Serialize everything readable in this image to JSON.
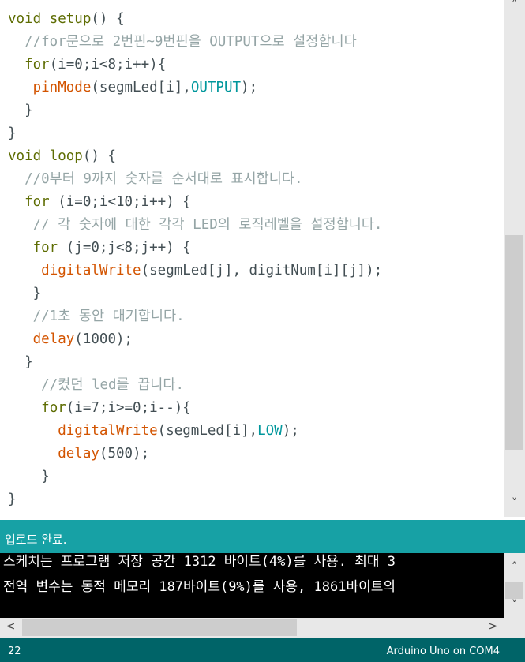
{
  "editor": {
    "lines": {
      "l1": {
        "a": "void",
        "b": " ",
        "c": "setup",
        "d": "() {"
      },
      "l2": {
        "a": "  //for문으로 2번핀~9번핀을 OUTPUT으로 설정합니다"
      },
      "l3": {
        "a": "  ",
        "b": "for",
        "c": "(i=0;i<8;i++){"
      },
      "l4": {
        "a": "   ",
        "b": "pinMode",
        "c": "(segmLed[i],",
        "d": "OUTPUT",
        "e": ");"
      },
      "l5": {
        "a": "  }"
      },
      "l6": {
        "a": "}"
      },
      "l7": {
        "a": "void",
        "b": " ",
        "c": "loop",
        "d": "() {"
      },
      "l8": {
        "a": "  //0부터 9까지 숫자를 순서대로 표시합니다."
      },
      "l9": {
        "a": "  ",
        "b": "for",
        "c": " (i=0;i<10;i++) {"
      },
      "l10": {
        "a": "   // 각 숫자에 대한 각각 LED의 로직레벨을 설정합니다."
      },
      "l11": {
        "a": "   ",
        "b": "for",
        "c": " (j=0;j<8;j++) {"
      },
      "l12": {
        "a": "    ",
        "b": "digitalWrite",
        "c": "(segmLed[j], digitNum[i][j]);"
      },
      "l13": {
        "a": "   }"
      },
      "l14": {
        "a": "   //1초 동안 대기합니다."
      },
      "l15": {
        "a": "   ",
        "b": "delay",
        "c": "(1000);"
      },
      "l16": {
        "a": "  }"
      },
      "l17": {
        "a": "    //켰던 led를 끕니다."
      },
      "l18": {
        "a": "    ",
        "b": "for",
        "c": "(i=7;i>=0;i--){"
      },
      "l19": {
        "a": "      ",
        "b": "digitalWrite",
        "c": "(segmLed[i],",
        "d": "LOW",
        "e": ");"
      },
      "l20": {
        "a": "      ",
        "b": "delay",
        "c": "(500);"
      },
      "l21": {
        "a": "    }"
      },
      "l22": {
        "a": "}"
      }
    }
  },
  "status": {
    "message": "업로드 완료."
  },
  "console": {
    "line1": "스케치는 프로그램 저장 공간 1312 바이트(4%)를 사용. 최대 3",
    "line2": "전역 변수는 동적 메모리 187바이트(9%)를 사용, 1861바이트의"
  },
  "scroll": {
    "up": "˄",
    "down": "˅",
    "left": "<",
    "right": ">"
  },
  "footer": {
    "line_number": "22",
    "board": "Arduino Uno on COM4"
  },
  "colors": {
    "keyword": "#d35400",
    "function_keyword": "#5e6d03",
    "constant": "#00979c",
    "comment": "#95a5a6",
    "status_bar": "#17a1a5",
    "footer": "#006468"
  }
}
